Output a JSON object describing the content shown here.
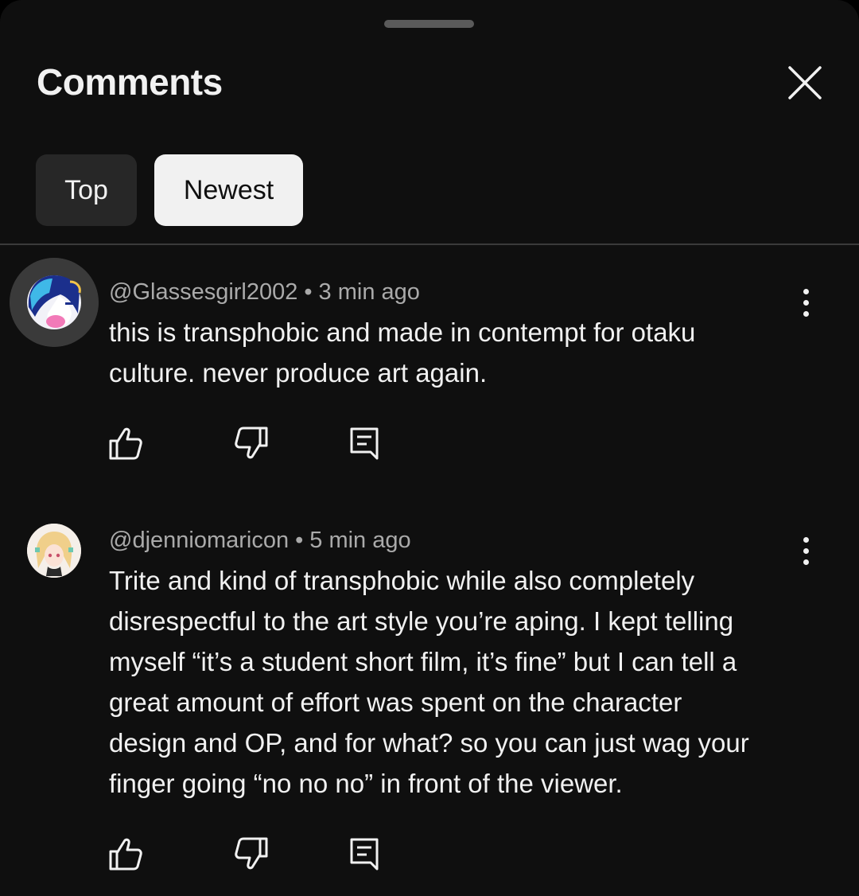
{
  "header": {
    "title": "Comments"
  },
  "filters": [
    {
      "label": "Top",
      "selected": false
    },
    {
      "label": "Newest",
      "selected": true
    }
  ],
  "comments": [
    {
      "author": "@Glassesgirl2002",
      "separator": "•",
      "time": "3 min ago",
      "lines": [
        "this is transphobic and made in contempt for otaku",
        "culture. never produce art again."
      ],
      "avatar_icon": "anime-avatar-dark-hair"
    },
    {
      "author": "@djenniomaricon",
      "separator": "•",
      "time": "5 min ago",
      "lines": [
        "Trite and kind of transphobic while also completely",
        "disrespectful to the art style you’re aping. I kept telling",
        "myself “it’s a student short film, it’s fine” but I can tell a",
        "great amount of effort was spent on the character",
        "design and OP, and for what? so you can just wag your",
        "finger going “no no no” in front of the viewer."
      ],
      "avatar_icon": "anime-avatar-blonde-hair"
    }
  ],
  "colors": {
    "background": "#0f0f0f",
    "text_primary": "#f1f1f1",
    "text_secondary": "#aaaaaa",
    "chip_inactive": "#272727",
    "chip_active": "#f1f1f1"
  }
}
